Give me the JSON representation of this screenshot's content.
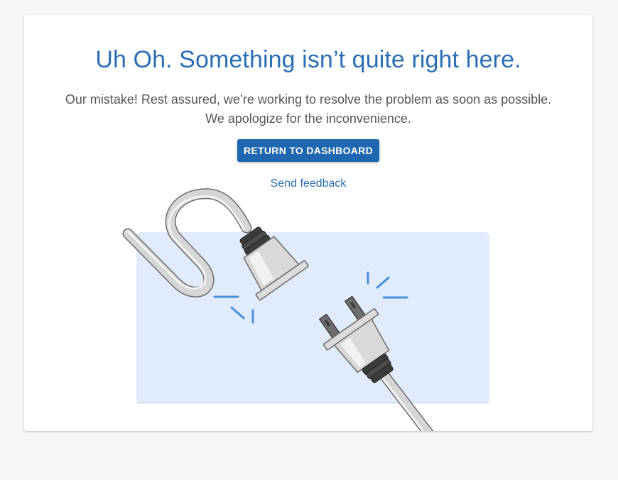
{
  "error_page": {
    "title": "Uh Oh. Something isn’t quite right here.",
    "message_line1": "Our mistake! Rest assured, we’re working to resolve the problem as soon as possible.",
    "message_line2": "We apologize for the inconvenience.",
    "return_button_label": "RETURN TO DASHBOARD",
    "feedback_link_label": "Send feedback"
  },
  "colors": {
    "accent": "#2a6fb5",
    "button": "#1f67b0",
    "illustration_bg": "#e0ebfb",
    "spark": "#4a8fdc"
  },
  "illustration": {
    "icon": "unplugged-cable-illustration"
  }
}
